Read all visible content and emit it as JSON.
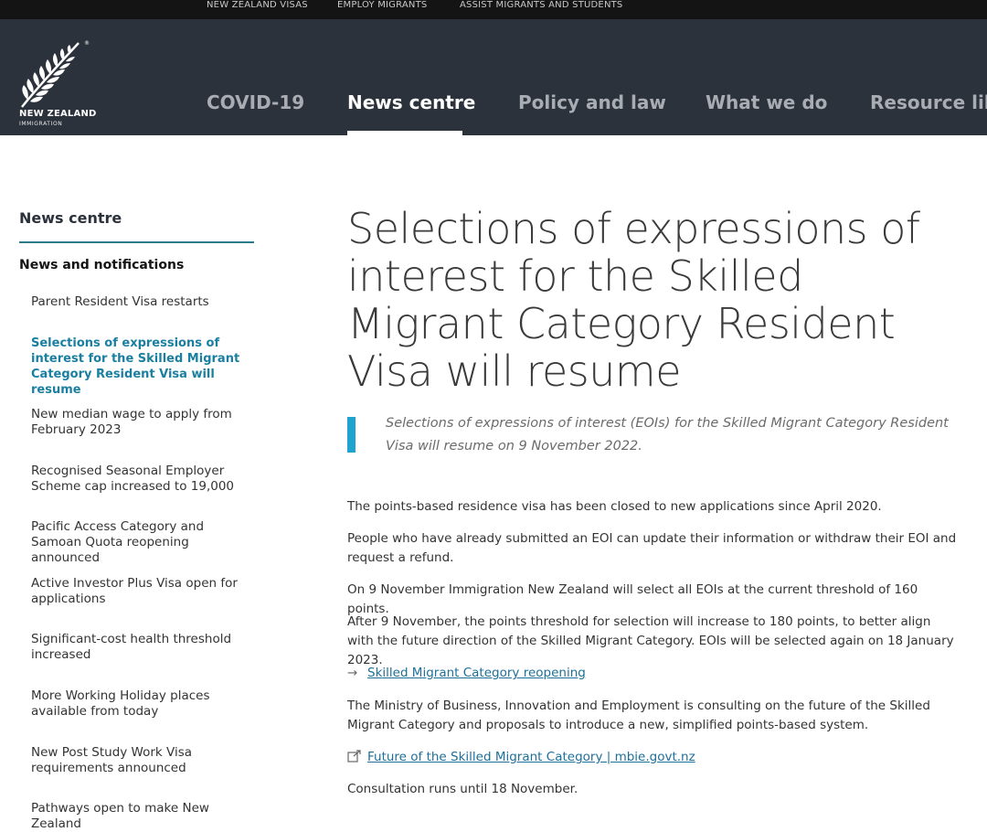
{
  "topbar": {
    "links": [
      "NEW ZEALAND VISAS",
      "EMPLOY MIGRANTS",
      "ASSIST MIGRANTS AND STUDENTS"
    ]
  },
  "logo": {
    "line1": "NEW ZEALAND",
    "line2": "IMMIGRATION",
    "icon": "silver-fern-icon"
  },
  "nav": {
    "items": [
      "COVID-19",
      "News centre",
      "Policy and law",
      "What we do",
      "Resource libr"
    ],
    "active_index": 1
  },
  "sidebar": {
    "title": "News centre",
    "subtitle": "News and notifications",
    "items": [
      "Parent Resident Visa restarts",
      "Selections of expressions of interest for the Skilled Migrant Category Resident Visa will resume",
      "New median wage to apply from February 2023",
      "Recognised Seasonal Employer Scheme cap increased to 19,000",
      "Pacific Access Category and Samoan Quota reopening announced",
      "Active Investor Plus Visa open for applications",
      "Significant-cost health threshold increased",
      "More Working Holiday places available from today",
      "New Post Study Work Visa requirements announced",
      "Pathways open to make New Zealand"
    ],
    "current_index": 1
  },
  "article": {
    "title": "Selections of expressions of interest for the Skilled Migrant Category Resident Visa will resume",
    "lead": "Selections of expressions of interest (EOIs) for the Skilled Migrant Category Resident Visa will resume on 9 November 2022.",
    "p1": "The points-based residence visa has been closed to new applications since April 2020.",
    "p2": "People who have already submitted an EOI can update their information or withdraw their EOI and request a refund.",
    "p3": "On 9 November Immigration New Zealand will select all EOIs at the current threshold of 160 points.",
    "p4": "After 9 November, the points threshold for selection will increase to 180 points, to better align with the future direction of the Skilled Migrant Category. EOIs will be selected again on 18 January 2023.",
    "link1": "Skilled Migrant Category reopening",
    "p5": "The Ministry of Business, Innovation and Employment is consulting on the future of the Skilled Migrant Category and proposals to introduce a new, simplified points-based system.",
    "link2": "Future of the Skilled Migrant Category | mbie.govt.nz",
    "p6": "Consultation runs until 18 November."
  },
  "colors": {
    "header_bg": "#2c323b",
    "accent": "#1fa3cf",
    "link": "#1e6f9a"
  }
}
